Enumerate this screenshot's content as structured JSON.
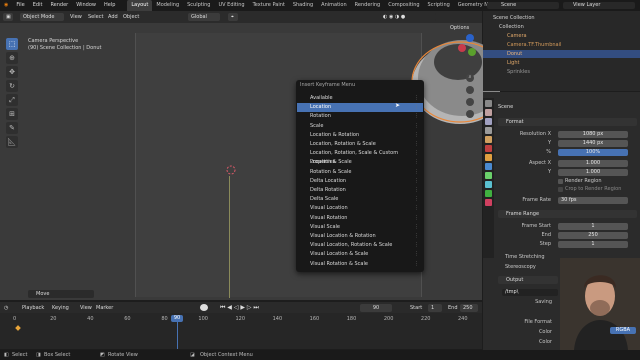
{
  "menubar": {
    "items": [
      "File",
      "Edit",
      "Render",
      "Window",
      "Help"
    ],
    "workspaces": [
      "Layout",
      "Modeling",
      "Sculpting",
      "UV Editing",
      "Texture Paint",
      "Shading",
      "Animation",
      "Rendering",
      "Compositing",
      "Scripting",
      "Geometry Nodes"
    ],
    "active_workspace": "Layout",
    "scene": "Scene",
    "view_layer": "View Layer"
  },
  "viewport": {
    "mode": "Object Mode",
    "menus": [
      "View",
      "Select",
      "Add",
      "Object"
    ],
    "orientation": "Global",
    "options": "Options",
    "info_line1": "Camera Perspective",
    "info_line2": "(90) Scene Collection | Donut",
    "operator_panel": "Move"
  },
  "insert_keyframe_menu": {
    "title": "Insert Keyframe Menu",
    "items": [
      "Available",
      "Location",
      "Rotation",
      "Scale",
      "Location & Rotation",
      "Location, Rotation & Scale",
      "Location, Rotation, Scale & Custom Properties",
      "Location & Scale",
      "Rotation & Scale",
      "Delta Location",
      "Delta Rotation",
      "Delta Scale",
      "Visual Location",
      "Visual Rotation",
      "Visual Scale",
      "Visual Location & Rotation",
      "Visual Location, Rotation & Scale",
      "Visual Location & Scale",
      "Visual Rotation & Scale"
    ],
    "highlighted": "Location"
  },
  "timeline": {
    "menus": [
      "Playback",
      "Keying",
      "View",
      "Marker"
    ],
    "current_frame": "90",
    "start_label": "Start",
    "start": "1",
    "end_label": "End",
    "end": "250",
    "ticks": [
      "0",
      "20",
      "40",
      "60",
      "80",
      "100",
      "120",
      "140",
      "160",
      "180",
      "200",
      "220",
      "240"
    ]
  },
  "statusbar": {
    "items": [
      "Select",
      "Box Select",
      "Rotate View",
      "Object Context Menu"
    ]
  },
  "outliner": {
    "rows": [
      "Scene Collection",
      "Collection",
      "Camera",
      "Camera.TF.Thumbnail",
      "Donut",
      "Light",
      "Sprinkles"
    ],
    "selected": "Donut"
  },
  "properties": {
    "scene_label": "Scene",
    "format_header": "Format",
    "resolution_x_label": "Resolution X",
    "resolution_x": "1080 px",
    "y_label": "Y",
    "resolution_y": "1440 px",
    "percent_label": "%",
    "resolution_pct": "100%",
    "aspect_x_label": "Aspect X",
    "aspect_x": "1.000",
    "aspect_y_label": "Y",
    "aspect_y": "1.000",
    "render_region": "Render Region",
    "crop_region": "Crop to Render Region",
    "frame_rate_label": "Frame Rate",
    "frame_rate": "30 fps",
    "frame_range_header": "Frame Range",
    "frame_start_label": "Frame Start",
    "frame_start": "1",
    "end_label": "End",
    "end": "250",
    "step_label": "Step",
    "step": "1",
    "time_stretching": "Time Stretching",
    "stereoscopy": "Stereoscopy",
    "output_header": "Output",
    "output_path": "/tmp\\",
    "saving_label": "Saving",
    "file_format_label": "File Format",
    "color_label": "Color",
    "color_label2": "Color",
    "rgba": "RGBA"
  },
  "colors": {
    "accent": "#4772b3",
    "selection": "#334d80",
    "menu_bg": "#181818"
  }
}
